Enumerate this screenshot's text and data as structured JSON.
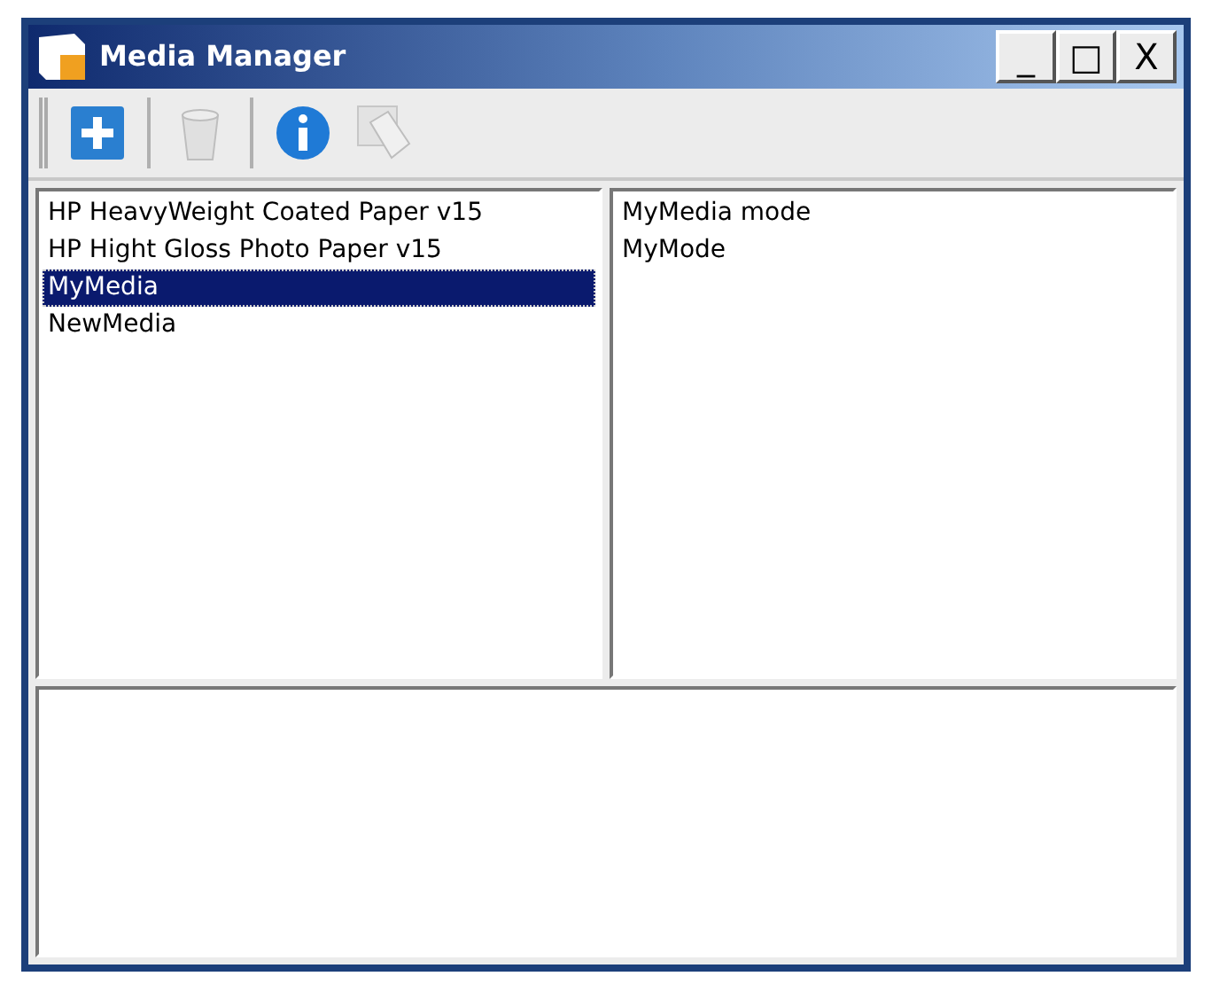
{
  "window": {
    "title": "Media Manager",
    "controls": [
      "_",
      "□",
      "X"
    ]
  },
  "toolbar": [
    {
      "kind": "add",
      "disabled": false
    },
    {
      "kind": "delete",
      "disabled": true
    },
    {
      "kind": "info",
      "disabled": false
    },
    {
      "kind": "tag",
      "disabled": true
    }
  ],
  "media_list": [
    {
      "label": "HP HeavyWeight Coated Paper v15",
      "selected": false
    },
    {
      "label": "HP Hight Gloss Photo Paper v15",
      "selected": false
    },
    {
      "label": "MyMedia",
      "selected": true
    },
    {
      "label": "NewMedia",
      "selected": false
    }
  ],
  "mode_list": [
    {
      "label": "MyMedia mode",
      "selected": false
    },
    {
      "label": "MyMode",
      "selected": false
    }
  ]
}
